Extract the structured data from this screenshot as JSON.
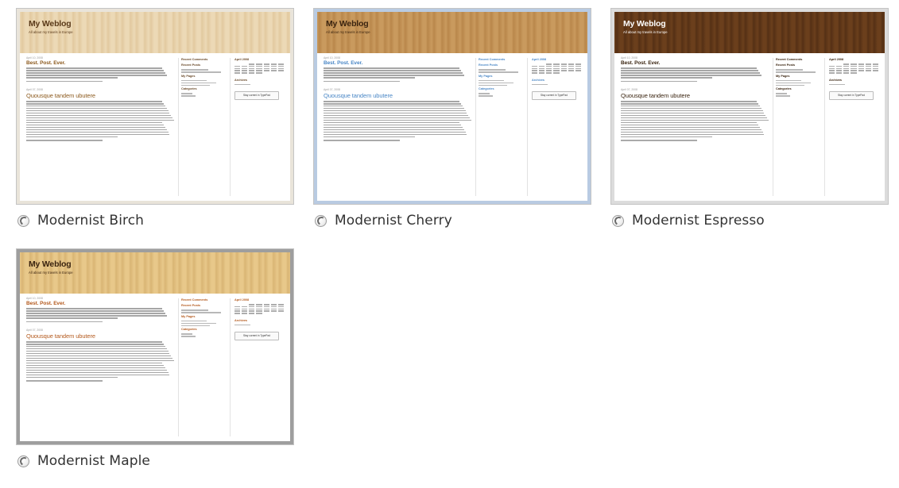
{
  "themes": [
    {
      "label": "Modernist Birch",
      "blog_title": "My Weblog",
      "blog_tagline": "All about my travels in Europe",
      "post1_date": "April 10, 2008",
      "post1_title": "Best. Post. Ever.",
      "post2_date": "April 07, 2008",
      "post2_title": "Quousque tandem ubutere",
      "sidebar_recent_comments": "Recent Comments",
      "sidebar_recent_posts": "Recent Posts",
      "sidebar_my_pages": "My Pages",
      "sidebar_categories": "Categories",
      "sidebar_archives": "Archives",
      "sidebar_calendar": "April 2008",
      "subscribe_label": "Stay current in TypePad",
      "colors": {
        "header_bg": "#ecd9b6",
        "header_stripe": "#e2c99f",
        "frame_bg": "#e9e4da",
        "title": "#5a3a1a",
        "post_title": "#8c5a1e",
        "side_head": "#6a4a2a"
      }
    },
    {
      "label": "Modernist Cherry",
      "blog_title": "My Weblog",
      "blog_tagline": "All about my travels in Europe",
      "post1_date": "April 10, 2008",
      "post1_title": "Best. Post. Ever.",
      "post2_date": "April 07, 2008",
      "post2_title": "Quousque tandem ubutere",
      "sidebar_recent_comments": "Recent Comments",
      "sidebar_recent_posts": "Recent Posts",
      "sidebar_my_pages": "My Pages",
      "sidebar_categories": "Categories",
      "sidebar_archives": "Archives",
      "sidebar_calendar": "April 2008",
      "subscribe_label": "Stay current in TypePad",
      "colors": {
        "header_bg": "#c99a5e",
        "header_stripe": "#b9874b",
        "frame_bg": "#b9cbe2",
        "title": "#3b2410",
        "post_title": "#4a87c6",
        "side_head": "#4a87c6"
      }
    },
    {
      "label": "Modernist Espresso",
      "blog_title": "My Weblog",
      "blog_tagline": "All about my travels in Europe",
      "post1_date": "April 10, 2008",
      "post1_title": "Best. Post. Ever.",
      "post2_date": "April 07, 2008",
      "post2_title": "Quousque tandem ubutere",
      "sidebar_recent_comments": "Recent Comments",
      "sidebar_recent_posts": "Recent Posts",
      "sidebar_my_pages": "My Pages",
      "sidebar_categories": "Categories",
      "sidebar_archives": "Archives",
      "sidebar_calendar": "April 2008",
      "subscribe_label": "Stay current in TypePad",
      "colors": {
        "header_bg": "#6b3f1c",
        "header_stripe": "#553015",
        "frame_bg": "#dcdcdc",
        "title": "#ffffff",
        "post_title": "#3a2410",
        "side_head": "#3a2410"
      }
    },
    {
      "label": "Modernist Maple",
      "blog_title": "My Weblog",
      "blog_tagline": "All about my travels in Europe",
      "post1_date": "April 10, 2008",
      "post1_title": "Best. Post. Ever.",
      "post2_date": "April 07, 2008",
      "post2_title": "Quousque tandem ubutere",
      "sidebar_recent_comments": "Recent Comments",
      "sidebar_recent_posts": "Recent Posts",
      "sidebar_my_pages": "My Pages",
      "sidebar_categories": "Categories",
      "sidebar_archives": "Archives",
      "sidebar_calendar": "April 2008",
      "subscribe_label": "Stay current in TypePad",
      "colors": {
        "header_bg": "#e8c88a",
        "header_stripe": "#d9b574",
        "frame_bg": "#9e9e9e",
        "title": "#3b2410",
        "post_title": "#b45a1e",
        "side_head": "#b45a1e"
      }
    }
  ]
}
